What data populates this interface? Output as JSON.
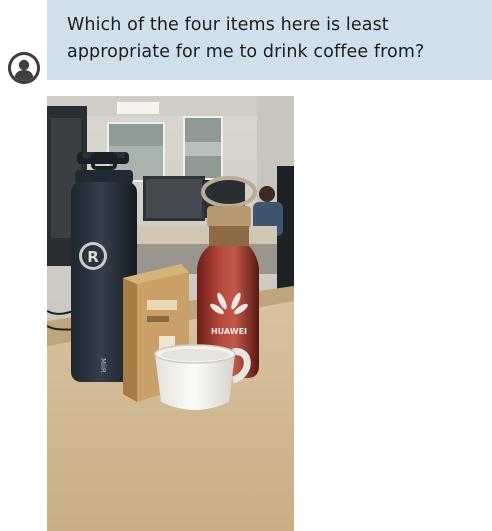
{
  "message": {
    "sender": "user",
    "text": "Which of the four items here is least appropriate for me to drink coffee from?",
    "avatar_icon": "user-avatar-icon"
  },
  "photo": {
    "bottle_logo_text": "HUAWEI",
    "flask_logo_letter": "R",
    "flask_side_text": "MiiR"
  },
  "colors": {
    "bubble": "#cfe0ec",
    "avatar": "#3f3f3f"
  }
}
